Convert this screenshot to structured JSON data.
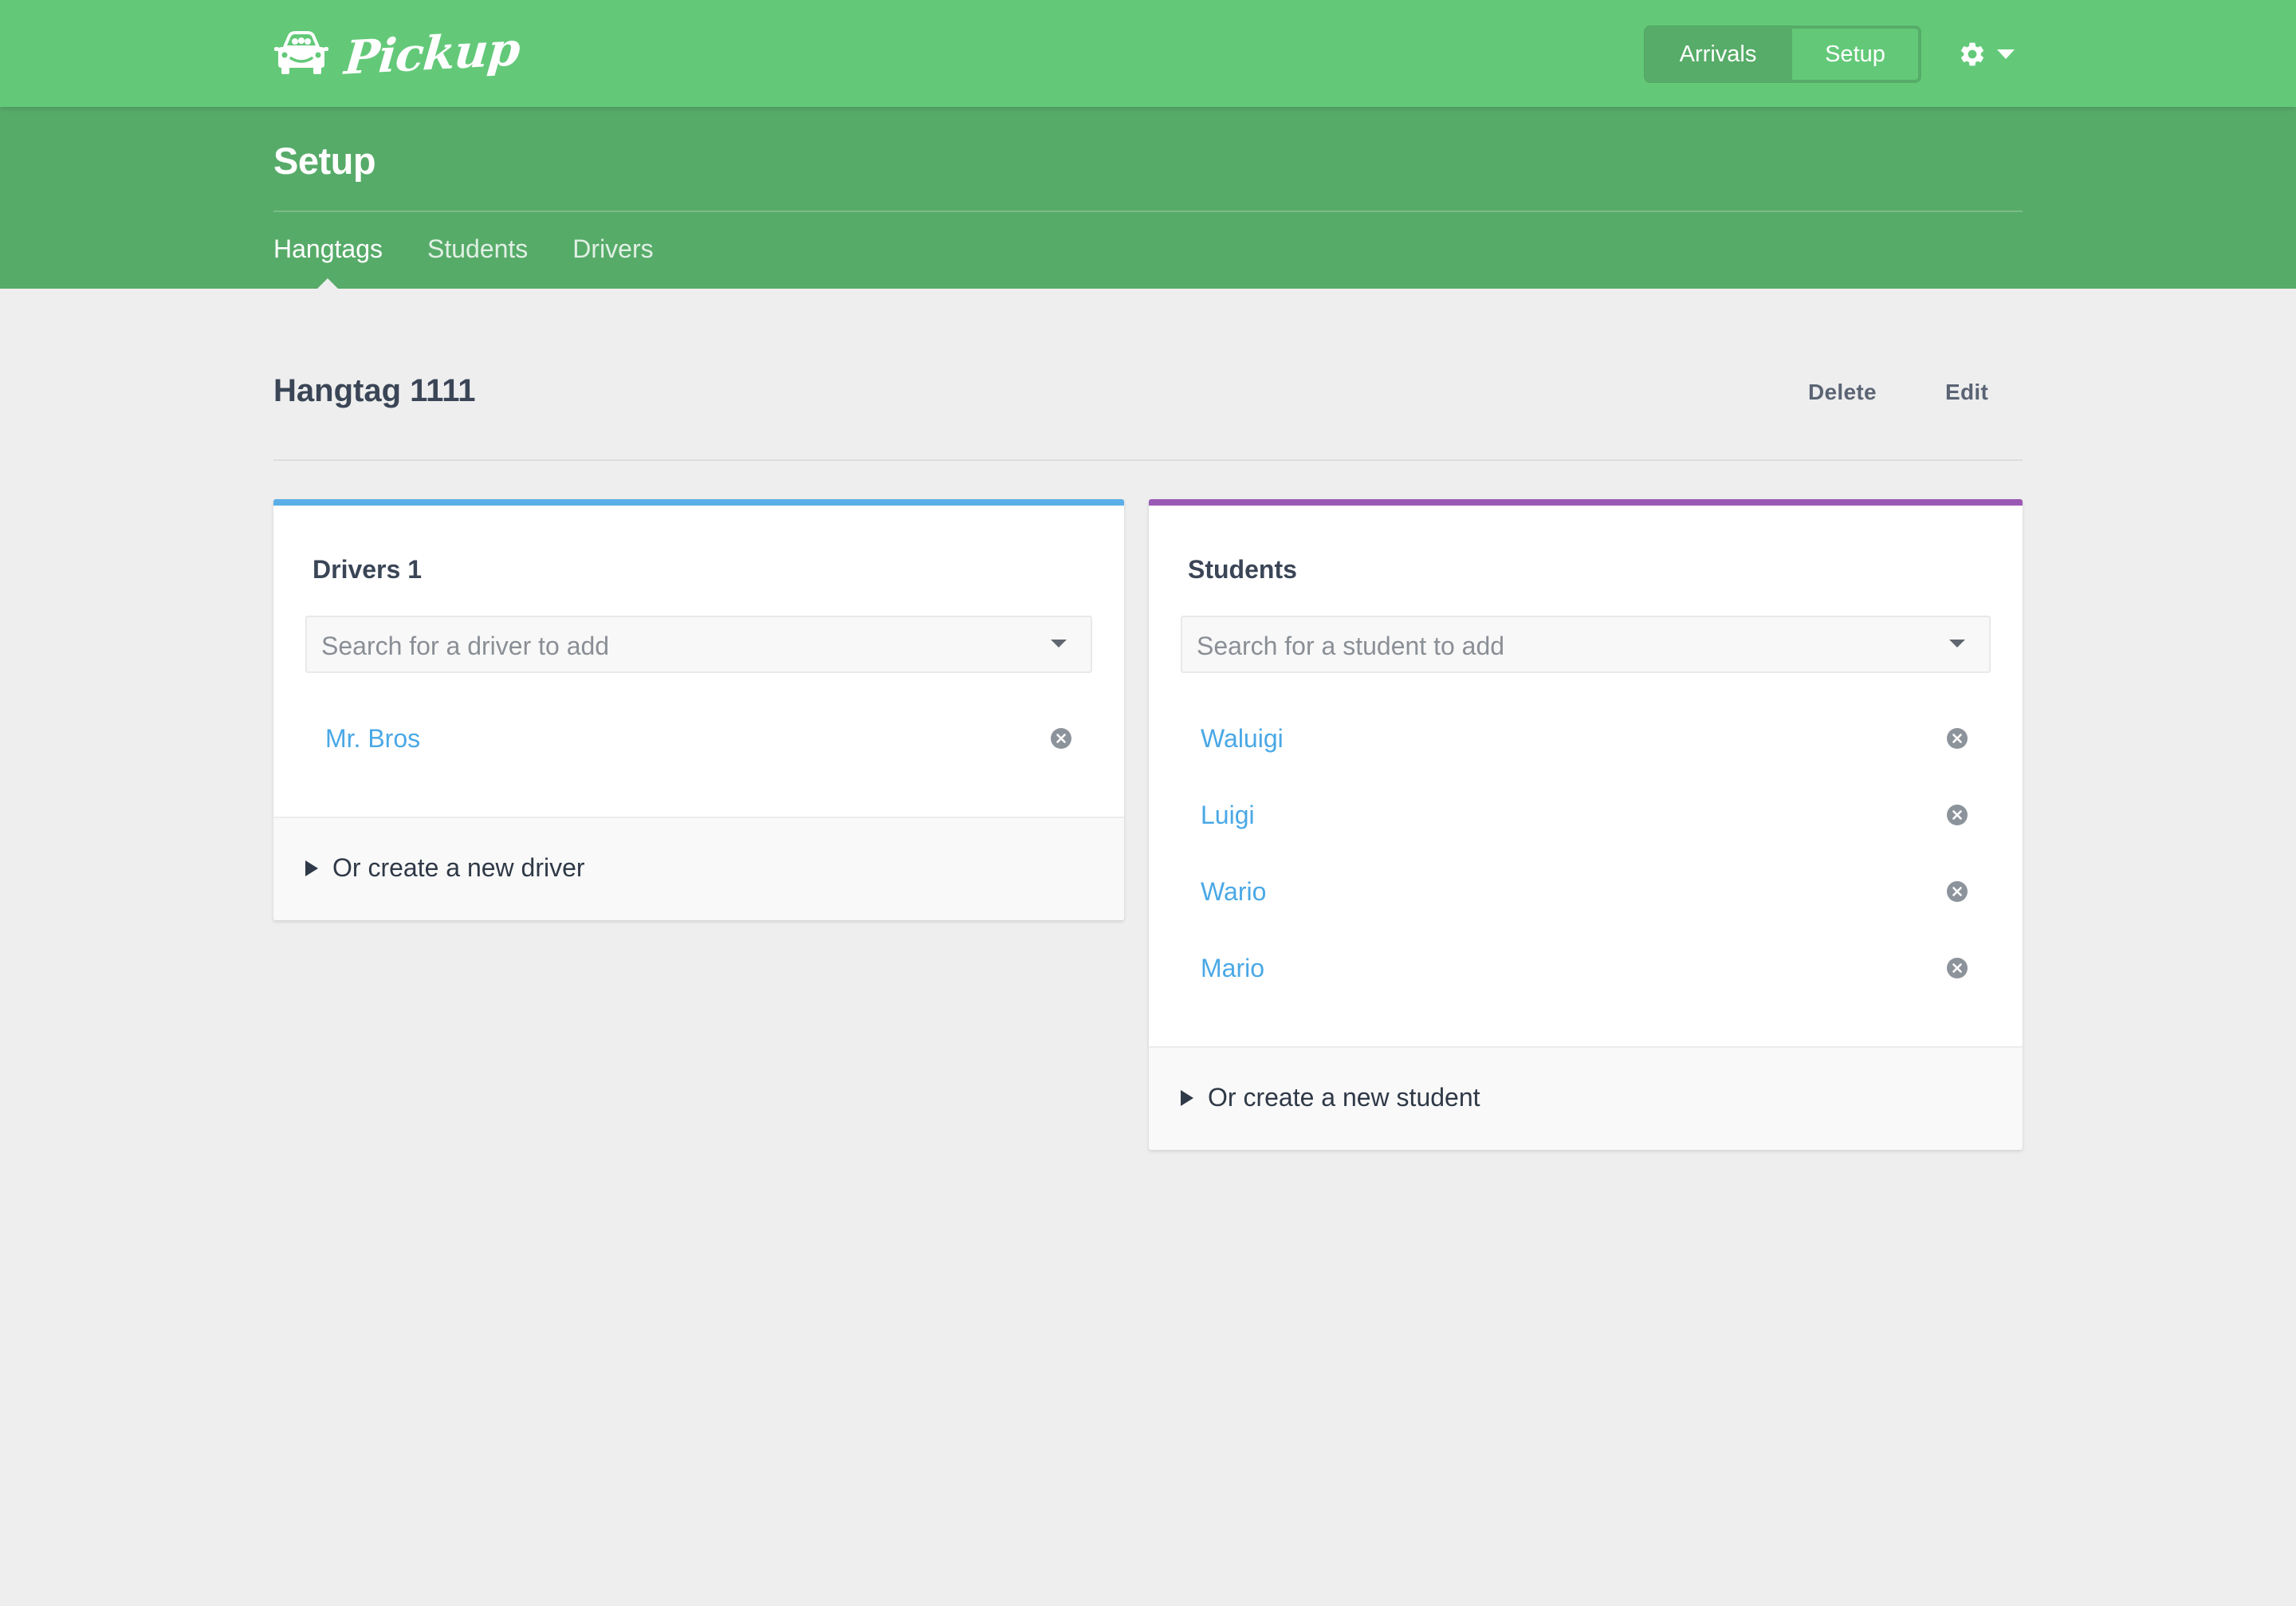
{
  "brand": {
    "logo_text": "Pickup",
    "logo_icon": "car-with-passengers-icon"
  },
  "navbar": {
    "mode_toggle": [
      {
        "label": "Arrivals",
        "active": false
      },
      {
        "label": "Setup",
        "active": true
      }
    ],
    "settings_icon": "gear-icon",
    "settings_caret_icon": "caret-down-icon"
  },
  "header": {
    "title": "Setup",
    "tabs": [
      {
        "label": "Hangtags",
        "active": true
      },
      {
        "label": "Students",
        "active": false
      },
      {
        "label": "Drivers",
        "active": false
      }
    ]
  },
  "hangtag": {
    "title": "Hangtag 1111",
    "delete_label": "Delete",
    "edit_label": "Edit"
  },
  "drivers_card": {
    "title": "Drivers 1",
    "accent_color": "#5aafe8",
    "search_placeholder": "Search for a driver to add",
    "items": [
      "Mr. Bros"
    ],
    "create_label": "Or create a new driver"
  },
  "students_card": {
    "title": "Students",
    "accent_color": "#9b59b6",
    "search_placeholder": "Search for a student to add",
    "items": [
      "Waluigi",
      "Luigi",
      "Wario",
      "Mario"
    ],
    "create_label": "Or create a new student"
  },
  "colors": {
    "navbar": "#63c979",
    "header": "#57ab69",
    "link": "#4aa8e6",
    "background": "#eeeeee"
  }
}
